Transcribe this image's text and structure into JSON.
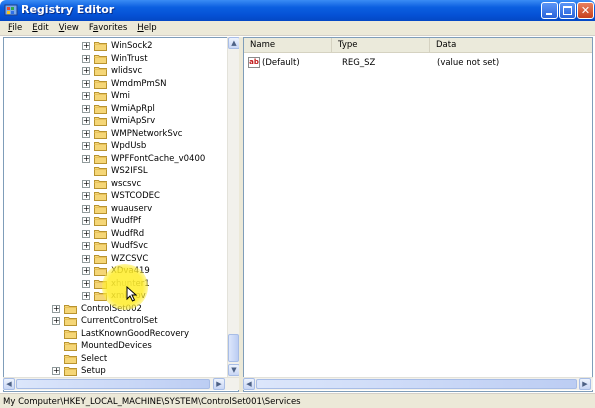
{
  "window": {
    "title": "Registry Editor"
  },
  "menu": [
    {
      "label": "File",
      "accel": "F",
      "rest": "ile"
    },
    {
      "label": "Edit",
      "accel": "E",
      "rest": "dit"
    },
    {
      "label": "View",
      "accel": "V",
      "rest": "iew"
    },
    {
      "label": "Favorites",
      "accel": "",
      "pre": "F",
      "accel2": "a",
      "rest": "vorites"
    },
    {
      "label": "Help",
      "accel": "H",
      "rest": "elp"
    }
  ],
  "tree": {
    "items": [
      {
        "label": "WinSock2",
        "expandable": true
      },
      {
        "label": "WinTrust",
        "expandable": true
      },
      {
        "label": "wlidsvc",
        "expandable": true
      },
      {
        "label": "WmdmPmSN",
        "expandable": true
      },
      {
        "label": "Wmi",
        "expandable": true
      },
      {
        "label": "WmiApRpl",
        "expandable": true
      },
      {
        "label": "WmiApSrv",
        "expandable": true
      },
      {
        "label": "WMPNetworkSvc",
        "expandable": true
      },
      {
        "label": "WpdUsb",
        "expandable": true
      },
      {
        "label": "WPFFontCache_v0400",
        "expandable": true
      },
      {
        "label": "WS2IFSL",
        "expandable": false
      },
      {
        "label": "wscsvc",
        "expandable": true
      },
      {
        "label": "WSTCODEC",
        "expandable": true
      },
      {
        "label": "wuauserv",
        "expandable": true
      },
      {
        "label": "WudfPf",
        "expandable": true
      },
      {
        "label": "WudfRd",
        "expandable": true
      },
      {
        "label": "WudfSvc",
        "expandable": true
      },
      {
        "label": "WZCSVC",
        "expandable": true
      },
      {
        "label": "XDva419",
        "expandable": true
      },
      {
        "label": "xhunter1",
        "expandable": true
      },
      {
        "label": "xmlprov",
        "expandable": true
      }
    ],
    "root_items": [
      {
        "label": "ControlSet002",
        "expandable": true
      },
      {
        "label": "CurrentControlSet",
        "expandable": true
      },
      {
        "label": "LastKnownGoodRecovery",
        "expandable": false
      },
      {
        "label": "MountedDevices",
        "expandable": false
      },
      {
        "label": "Select",
        "expandable": false
      },
      {
        "label": "Setup",
        "expandable": true
      }
    ]
  },
  "list": {
    "columns": [
      "Name",
      "Type",
      "Data"
    ],
    "rows": [
      {
        "name": "(Default)",
        "type": "REG_SZ",
        "data": "(value not set)",
        "icon": "string-value-icon"
      }
    ]
  },
  "status": {
    "path": "My Computer\\HKEY_LOCAL_MACHINE\\SYSTEM\\ControlSet001\\Services"
  },
  "colors": {
    "titlebar": "#0552d6",
    "chrome": "#ece9d8",
    "folder": "#f5d677",
    "cursor_highlight": "#ffec28"
  }
}
